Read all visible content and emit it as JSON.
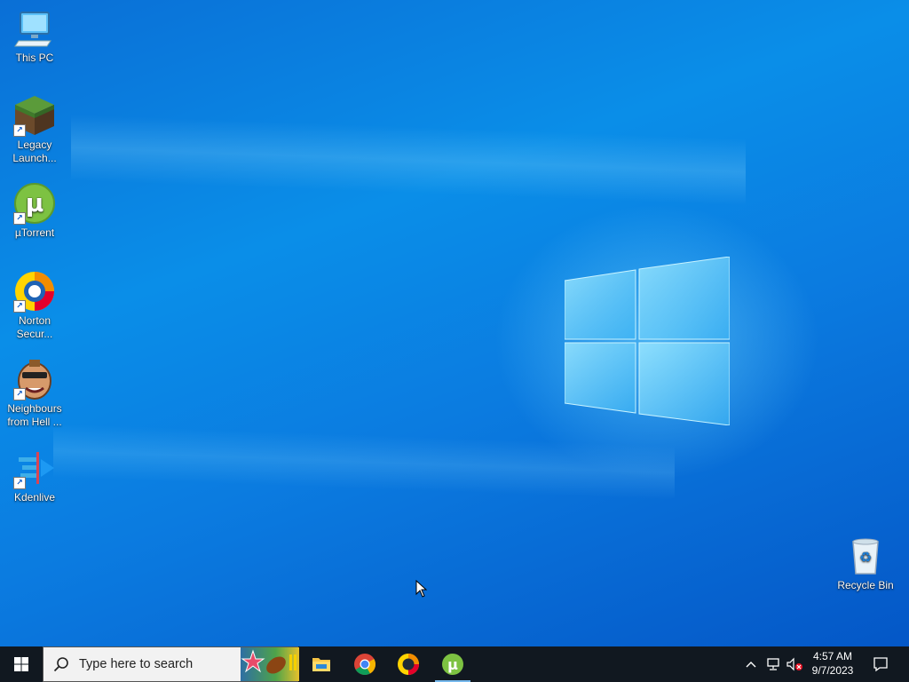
{
  "desktop": {
    "icons": [
      {
        "label": "This PC",
        "icon": "this-pc-icon"
      },
      {
        "label": "Legacy Launch...",
        "icon": "minecraft-grass-block-icon"
      },
      {
        "label": "µTorrent",
        "icon": "utorrent-icon"
      },
      {
        "label": "Norton Secur...",
        "icon": "norton-security-icon"
      },
      {
        "label": "Neighbours from Hell ...",
        "icon": "neighbours-from-hell-icon"
      },
      {
        "label": "Kdenlive",
        "icon": "kdenlive-icon"
      }
    ],
    "recycle_bin": {
      "label": "Recycle Bin",
      "icon": "recycle-bin-icon"
    }
  },
  "taskbar": {
    "search_placeholder": "Type here to search",
    "pinned_apps": [
      {
        "name": "File Explorer",
        "icon": "file-explorer-icon"
      },
      {
        "name": "Google Chrome",
        "icon": "chrome-icon"
      },
      {
        "name": "Norton",
        "icon": "norton-icon"
      },
      {
        "name": "µTorrent",
        "icon": "utorrent-icon",
        "active": true
      }
    ],
    "tray": {
      "time": "4:57 AM",
      "date": "9/7/2023"
    }
  },
  "colors": {
    "taskbar_bg": "#111820",
    "accent": "#76b9ed",
    "desktop_blue": "#0a8ee8"
  }
}
